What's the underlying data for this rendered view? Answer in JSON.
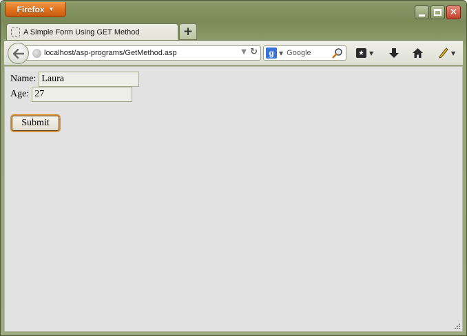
{
  "app": {
    "menu_button_label": "Firefox",
    "caret_glyph": "▼"
  },
  "window_controls": {
    "close_glyph": "✕"
  },
  "tabs": [
    {
      "title": "A Simple Form Using GET Method",
      "active": true
    }
  ],
  "new_tab_label": "+",
  "navbar": {
    "back_glyph": "🡐",
    "url": "localhost/asp-programs/GetMethod.asp",
    "reload_glyph": "↻",
    "search_engine_letter": "g",
    "search_placeholder": "Google",
    "icons": [
      "back-icon",
      "site-identity-icon",
      "reload-icon",
      "google-icon",
      "search-icon",
      "bookmarks-icon",
      "downloads-icon",
      "home-icon",
      "pencil-icon"
    ]
  },
  "form": {
    "name_label": "Name:",
    "name_value": "Laura",
    "age_label": "Age:",
    "age_value": "27",
    "submit_label": "Submit"
  },
  "colors": {
    "firefox_orange": "#e2741f",
    "window_frame": "#8c9a6b",
    "page_background": "#e2e2e2",
    "submit_focus_ring": "#d8923c"
  }
}
